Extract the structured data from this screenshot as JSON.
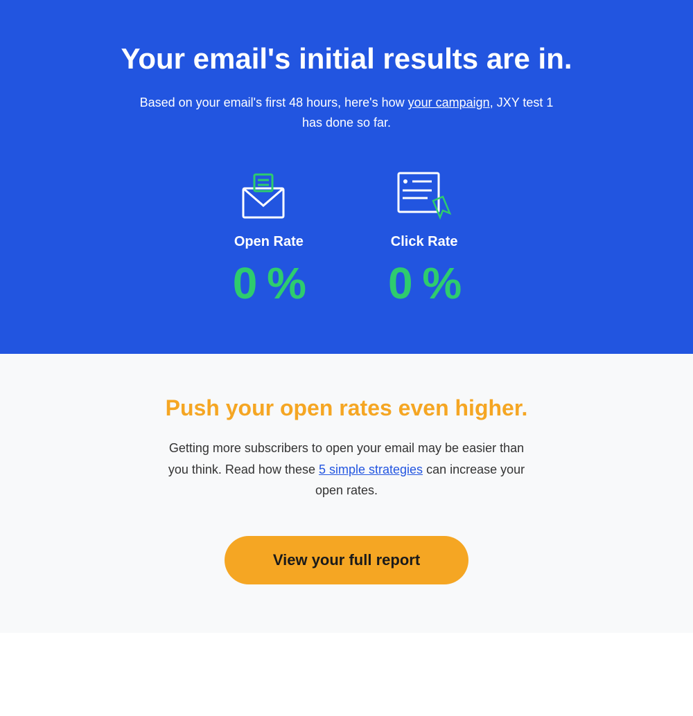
{
  "header": {
    "title": "Your email's initial results are in.",
    "subtitle_plain": "Based on your email's first 48 hours, here's how ",
    "subtitle_link_text": "your campaign",
    "subtitle_after_link": ", JXY test 1 has done so far."
  },
  "metrics": [
    {
      "id": "open-rate",
      "label": "Open Rate",
      "value": "0",
      "unit": "%",
      "icon": "email-open-icon"
    },
    {
      "id": "click-rate",
      "label": "Click Rate",
      "value": "0",
      "unit": "%",
      "icon": "cursor-click-icon"
    }
  ],
  "promo": {
    "title": "Push your open rates even higher.",
    "text_before_link": "Getting more subscribers to open your email may be easier than you think. Read how these ",
    "link_text": "5 simple strategies",
    "text_after_link": " can increase your open rates."
  },
  "cta": {
    "label": "View your full report"
  },
  "colors": {
    "blue_bg": "#2255e0",
    "green_metric": "#2ecc6e",
    "orange_promo": "#f5a623",
    "orange_button": "#f5a623",
    "link_blue": "#2255e0"
  }
}
